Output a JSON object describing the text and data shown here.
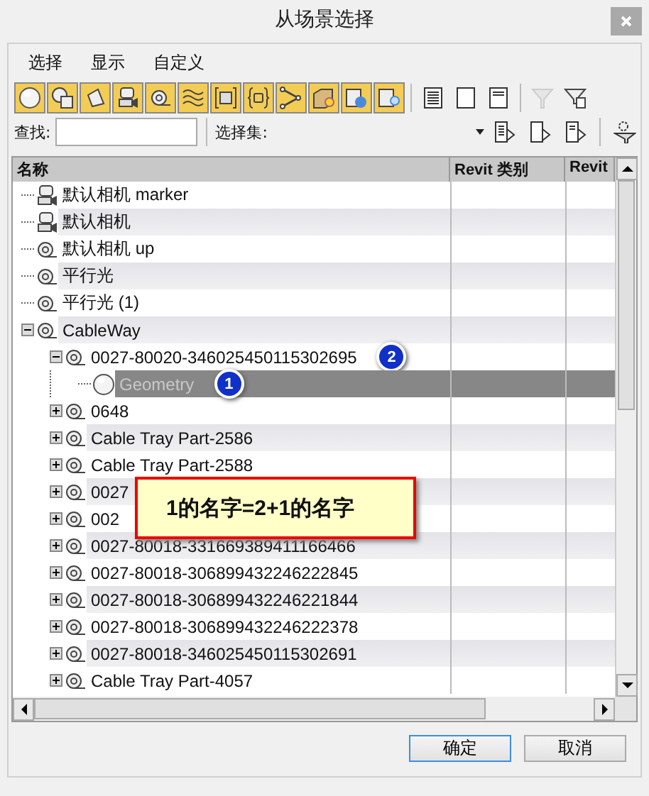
{
  "window": {
    "title": "从场景选择"
  },
  "menu": [
    {
      "label": "选择"
    },
    {
      "label": "显示"
    },
    {
      "label": "自定义"
    }
  ],
  "toolbar": [
    {
      "kind": "geometry",
      "selected": true
    },
    {
      "kind": "shape",
      "selected": true
    },
    {
      "kind": "light",
      "selected": true
    },
    {
      "kind": "camera",
      "selected": true
    },
    {
      "kind": "helper",
      "selected": true
    },
    {
      "kind": "spacewarp",
      "selected": true
    },
    {
      "kind": "group",
      "selected": true
    },
    {
      "kind": "container",
      "selected": true
    },
    {
      "kind": "bone",
      "selected": true
    },
    {
      "kind": "xref",
      "selected": true
    },
    {
      "kind": "frozen",
      "selected": true
    },
    {
      "kind": "hidden",
      "selected": true
    }
  ],
  "display_buttons": [
    {
      "kind": "all"
    },
    {
      "kind": "none"
    },
    {
      "kind": "invert"
    }
  ],
  "filter_buttons": [
    {
      "kind": "filter",
      "disabled": true
    },
    {
      "kind": "filter-settings",
      "disabled": false
    }
  ],
  "search": {
    "label": "查找:"
  },
  "selection_set": {
    "label": "选择集:"
  },
  "set_buttons": [
    {
      "kind": "doc-arrow"
    },
    {
      "kind": "doc-plain"
    },
    {
      "kind": "doc-lines"
    },
    {
      "kind": "find-case"
    }
  ],
  "table": {
    "columns": [
      "名称",
      "Revit 类别",
      "Revit"
    ],
    "rows": [
      {
        "label": "默认相机 marker",
        "kind": "camera",
        "selected": false
      },
      {
        "label": "默认相机",
        "kind": "camera",
        "selected": false
      },
      {
        "label": "默认相机 up",
        "kind": "object",
        "selected": false
      },
      {
        "label": "平行光",
        "kind": "object",
        "selected": false
      },
      {
        "label": "平行光 (1)",
        "kind": "object",
        "selected": false
      },
      {
        "label": "CableWay",
        "kind": "object",
        "expanded": true,
        "selected": false,
        "children": [
          {
            "label": "0027-80020-346025450115302695",
            "kind": "object",
            "expanded": true,
            "selected": false,
            "badge": "2",
            "children": [
              {
                "label": "Geometry",
                "kind": "geometry",
                "selected": true,
                "badge": "1"
              }
            ]
          },
          {
            "label": "0648",
            "kind": "object",
            "expanded": false,
            "selected": false
          },
          {
            "label": "Cable Tray Part-2586",
            "kind": "object",
            "expanded": false,
            "selected": false
          },
          {
            "label": "Cable Tray Part-2588",
            "kind": "object",
            "expanded": false,
            "selected": false
          },
          {
            "label": "0027",
            "kind": "object",
            "expanded": false,
            "selected": false
          },
          {
            "label": "002",
            "kind": "object",
            "expanded": false,
            "selected": false
          },
          {
            "label": "0027-80018-331669389411166466",
            "kind": "object",
            "expanded": false,
            "selected": false
          },
          {
            "label": "0027-80018-306899432246222845",
            "kind": "object",
            "expanded": false,
            "selected": false
          },
          {
            "label": "0027-80018-306899432246221844",
            "kind": "object",
            "expanded": false,
            "selected": false
          },
          {
            "label": "0027-80018-306899432246222378",
            "kind": "object",
            "expanded": false,
            "selected": false
          },
          {
            "label": "0027-80018-346025450115302691",
            "kind": "object",
            "expanded": false,
            "selected": false
          },
          {
            "label": "Cable Tray Part-4057",
            "kind": "object",
            "expanded": false,
            "selected": false
          }
        ]
      }
    ]
  },
  "callout": {
    "text": "1的名字=2+1的名字"
  },
  "buttons": [
    {
      "label": "确定",
      "default": true
    },
    {
      "label": "取消",
      "default": false
    }
  ]
}
